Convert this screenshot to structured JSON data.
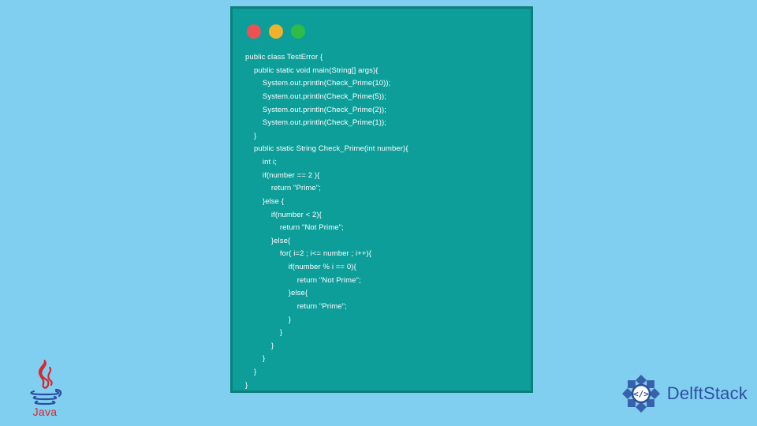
{
  "window": {
    "dots": [
      "red",
      "yellow",
      "green"
    ]
  },
  "code": {
    "lines": [
      "public class TestError {",
      "    public static void main(String[] args){",
      "        System.out.println(Check_Prime(10));",
      "        System.out.println(Check_Prime(5));",
      "        System.out.println(Check_Prime(2));",
      "        System.out.println(Check_Prime(1));",
      "    }",
      "    public static String Check_Prime(int number){",
      "        int i;",
      "        if(number == 2 ){",
      "            return \"Prime\";",
      "        }else {",
      "            if(number < 2){",
      "                return \"Not Prime\";",
      "            }else{",
      "                for( i=2 ; i<= number ; i++){",
      "                    if(number % i == 0){",
      "                        return \"Not Prime\";",
      "                    }else{",
      "                        return \"Prime\";",
      "                    }",
      "                }",
      "            }",
      "        }",
      "    }",
      "}"
    ]
  },
  "logos": {
    "java_label": "Java",
    "delft_label": "DelftStack"
  },
  "colors": {
    "page_bg": "#81cff0",
    "window_bg": "#0e9e9a",
    "window_border": "#0b7f7c",
    "code_text": "#ffffff",
    "java_red": "#d8262c",
    "delft_blue": "#2c4ea0"
  }
}
